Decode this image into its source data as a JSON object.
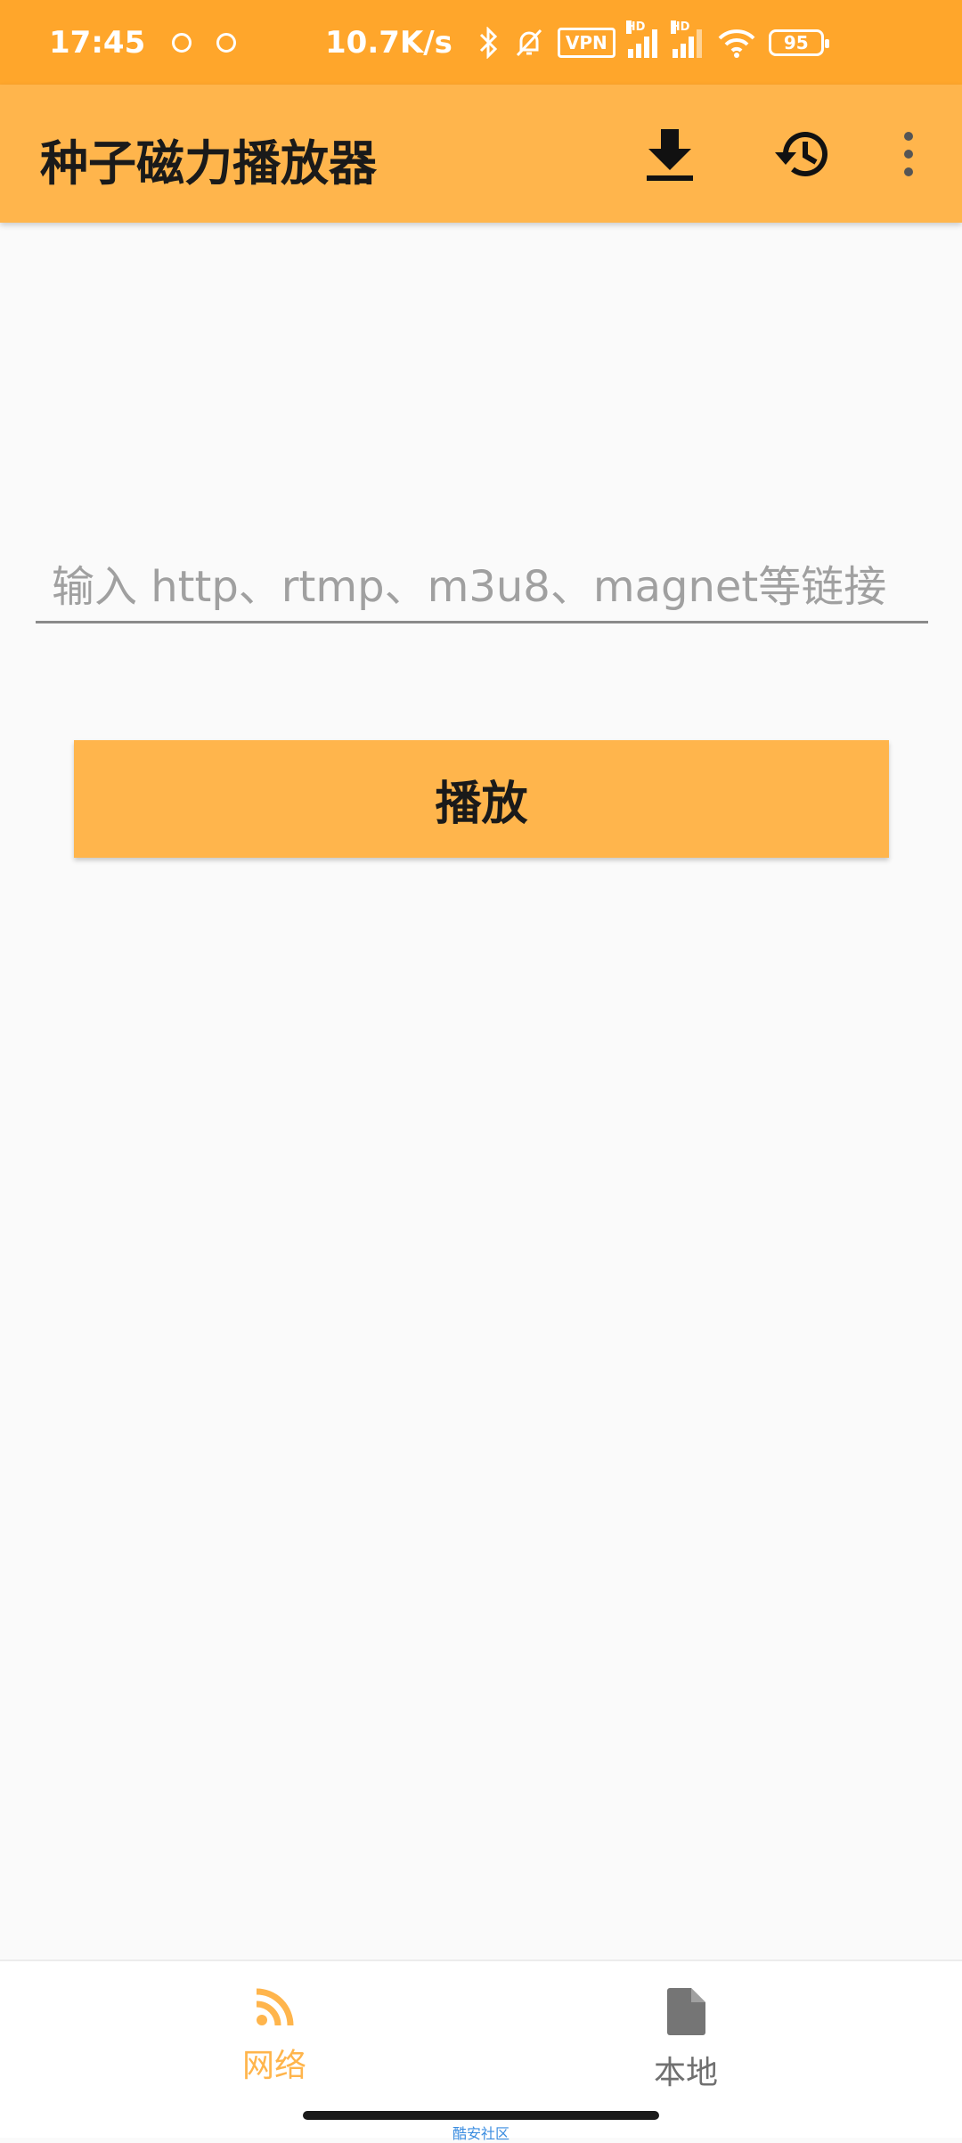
{
  "status_bar": {
    "time": "17:45",
    "net_speed": "10.7K/s",
    "vpn": "VPN",
    "hd": "HD",
    "battery": "95"
  },
  "app_bar": {
    "title": "种子磁力播放器",
    "icons": [
      "download-icon",
      "history-icon",
      "more-vert-icon"
    ]
  },
  "main": {
    "url_placeholder": "输入 http、rtmp、m3u8、magnet等链接",
    "url_value": "",
    "play_label": "播放"
  },
  "bottom_nav": {
    "items": [
      {
        "label": "网络",
        "icon": "rss-icon",
        "selected": true
      },
      {
        "label": "本地",
        "icon": "file-icon",
        "selected": false
      }
    ]
  },
  "colors": {
    "status_bar": "#ffa62b",
    "accent": "#ffb54c",
    "background": "#fafafa"
  },
  "watermark": "酷安社区"
}
